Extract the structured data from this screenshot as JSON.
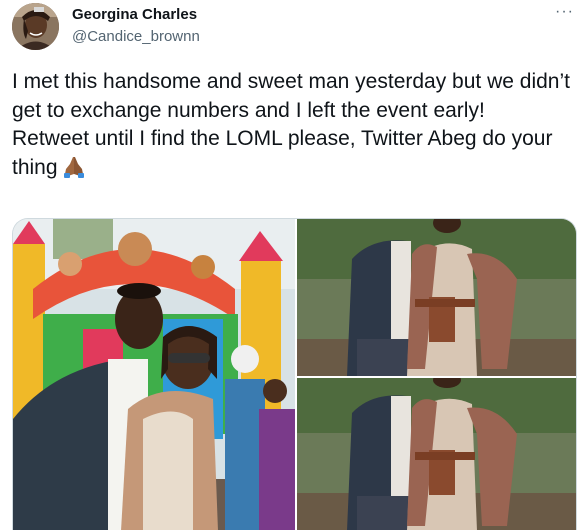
{
  "author": {
    "display_name": "Georgina Charles",
    "handle": "@Candice_brownn",
    "avatar_icon": "profile-photo"
  },
  "more_icon": "more-options-icon",
  "more_label": "···",
  "tweet": {
    "line1": "I met this handsome and sweet man yesterday but we didn’t get to exchange numbers and I left the event early!",
    "line2": "Retweet until I find the LOML please, Twitter Abeg do your thing",
    "emoji": "folded-hands-emoji"
  },
  "media": {
    "photos": [
      {
        "name": "photo-bouncy-castle-couple"
      },
      {
        "name": "photo-couple-outdoors-top"
      },
      {
        "name": "photo-couple-outdoors-bottom"
      }
    ]
  },
  "colors": {
    "text": "#0f1419",
    "secondary": "#536471",
    "border": "#cfd9de"
  }
}
